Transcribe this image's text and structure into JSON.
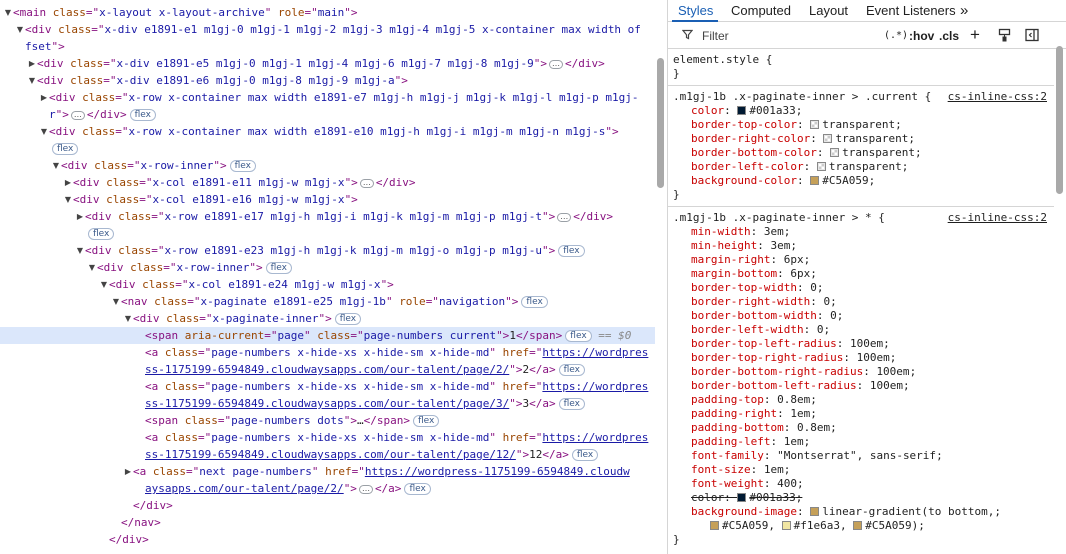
{
  "elements": {
    "lines": [
      {
        "indent": 0,
        "tri": "open",
        "parts": [
          [
            "tag",
            "<main "
          ],
          [
            "an",
            "class"
          ],
          [
            "tag",
            "=\""
          ],
          [
            "av",
            "x-layout x-layout-archive"
          ],
          [
            "tag",
            "\" "
          ],
          [
            "an",
            "role"
          ],
          [
            "tag",
            "=\""
          ],
          [
            "av",
            "main"
          ],
          [
            "tag",
            "\">"
          ]
        ]
      },
      {
        "indent": 1,
        "tri": "open",
        "parts": [
          [
            "tag",
            "<div "
          ],
          [
            "an",
            "class"
          ],
          [
            "tag",
            "=\""
          ],
          [
            "av",
            "x-div e1891-e1 m1gj-0 m1gj-1 m1gj-2 m1gj-3 m1gj-4 m1gj-5 x-container max width of"
          ]
        ]
      },
      {
        "indent": 1,
        "cont": true,
        "parts": [
          [
            "av",
            "fset"
          ],
          [
            "tag",
            "\">"
          ]
        ]
      },
      {
        "indent": 2,
        "tri": "closed",
        "parts": [
          [
            "tag",
            "<div "
          ],
          [
            "an",
            "class"
          ],
          [
            "tag",
            "=\""
          ],
          [
            "av",
            "x-div e1891-e5 m1gj-0 m1gj-1 m1gj-4 m1gj-6 m1gj-7 m1gj-8 m1gj-9"
          ],
          [
            "tag",
            "\">"
          ],
          [
            "ell",
            "…"
          ],
          [
            "tag",
            "</div>"
          ]
        ]
      },
      {
        "indent": 2,
        "tri": "open",
        "parts": [
          [
            "tag",
            "<div "
          ],
          [
            "an",
            "class"
          ],
          [
            "tag",
            "=\""
          ],
          [
            "av",
            "x-div e1891-e6 m1gj-0 m1gj-8 m1gj-9 m1gj-a"
          ],
          [
            "tag",
            "\">"
          ]
        ]
      },
      {
        "indent": 3,
        "tri": "closed",
        "parts": [
          [
            "tag",
            "<div "
          ],
          [
            "an",
            "class"
          ],
          [
            "tag",
            "=\""
          ],
          [
            "av",
            "x-row x-container max width e1891-e7 m1gj-h m1gj-j m1gj-k m1gj-l m1gj-p m1gj-"
          ]
        ]
      },
      {
        "indent": 3,
        "cont": true,
        "parts": [
          [
            "av",
            "r"
          ],
          [
            "tag",
            "\">"
          ],
          [
            "ell",
            "…"
          ],
          [
            "tag",
            "</div>"
          ],
          [
            "badge",
            "flex"
          ]
        ]
      },
      {
        "indent": 3,
        "tri": "open",
        "parts": [
          [
            "tag",
            "<div "
          ],
          [
            "an",
            "class"
          ],
          [
            "tag",
            "=\""
          ],
          [
            "av",
            "x-row x-container max width e1891-e10 m1gj-h m1gj-i m1gj-m m1gj-n m1gj-s"
          ],
          [
            "tag",
            "\">"
          ]
        ]
      },
      {
        "indent": 3,
        "cont": true,
        "parts": [
          [
            "badge",
            "flex"
          ]
        ]
      },
      {
        "indent": 4,
        "tri": "open",
        "parts": [
          [
            "tag",
            "<div "
          ],
          [
            "an",
            "class"
          ],
          [
            "tag",
            "=\""
          ],
          [
            "av",
            "x-row-inner"
          ],
          [
            "tag",
            "\">"
          ],
          [
            "badge",
            "flex"
          ]
        ]
      },
      {
        "indent": 5,
        "tri": "closed",
        "parts": [
          [
            "tag",
            "<div "
          ],
          [
            "an",
            "class"
          ],
          [
            "tag",
            "=\""
          ],
          [
            "av",
            "x-col e1891-e11 m1gj-w m1gj-x"
          ],
          [
            "tag",
            "\">"
          ],
          [
            "ell",
            "…"
          ],
          [
            "tag",
            "</div>"
          ]
        ]
      },
      {
        "indent": 5,
        "tri": "open",
        "parts": [
          [
            "tag",
            "<div "
          ],
          [
            "an",
            "class"
          ],
          [
            "tag",
            "=\""
          ],
          [
            "av",
            "x-col e1891-e16 m1gj-w m1gj-x"
          ],
          [
            "tag",
            "\">"
          ]
        ]
      },
      {
        "indent": 6,
        "tri": "closed",
        "parts": [
          [
            "tag",
            "<div "
          ],
          [
            "an",
            "class"
          ],
          [
            "tag",
            "=\""
          ],
          [
            "av",
            "x-row e1891-e17 m1gj-h m1gj-i m1gj-k m1gj-m m1gj-p m1gj-t"
          ],
          [
            "tag",
            "\">"
          ],
          [
            "ell",
            "…"
          ],
          [
            "tag",
            "</div>"
          ]
        ]
      },
      {
        "indent": 6,
        "cont": true,
        "parts": [
          [
            "badge",
            "flex"
          ]
        ]
      },
      {
        "indent": 6,
        "tri": "open",
        "parts": [
          [
            "tag",
            "<div "
          ],
          [
            "an",
            "class"
          ],
          [
            "tag",
            "=\""
          ],
          [
            "av",
            "x-row e1891-e23 m1gj-h m1gj-k m1gj-m m1gj-o m1gj-p m1gj-u"
          ],
          [
            "tag",
            "\">"
          ],
          [
            "badge",
            "flex"
          ]
        ]
      },
      {
        "indent": 7,
        "tri": "open",
        "parts": [
          [
            "tag",
            "<div "
          ],
          [
            "an",
            "class"
          ],
          [
            "tag",
            "=\""
          ],
          [
            "av",
            "x-row-inner"
          ],
          [
            "tag",
            "\">"
          ],
          [
            "badge",
            "flex"
          ]
        ]
      },
      {
        "indent": 8,
        "tri": "open",
        "parts": [
          [
            "tag",
            "<div "
          ],
          [
            "an",
            "class"
          ],
          [
            "tag",
            "=\""
          ],
          [
            "av",
            "x-col e1891-e24 m1gj-w m1gj-x"
          ],
          [
            "tag",
            "\">"
          ]
        ]
      },
      {
        "indent": 9,
        "tri": "open",
        "parts": [
          [
            "tag",
            "<nav "
          ],
          [
            "an",
            "class"
          ],
          [
            "tag",
            "=\""
          ],
          [
            "av",
            "x-paginate e1891-e25 m1gj-1b"
          ],
          [
            "tag",
            "\" "
          ],
          [
            "an",
            "role"
          ],
          [
            "tag",
            "=\""
          ],
          [
            "av",
            "navigation"
          ],
          [
            "tag",
            "\">"
          ],
          [
            "badge",
            "flex"
          ]
        ]
      },
      {
        "indent": 10,
        "tri": "open",
        "parts": [
          [
            "tag",
            "<div "
          ],
          [
            "an",
            "class"
          ],
          [
            "tag",
            "=\""
          ],
          [
            "av",
            "x-paginate-inner"
          ],
          [
            "tag",
            "\">"
          ],
          [
            "badge",
            "flex"
          ]
        ]
      },
      {
        "indent": 11,
        "selected": true,
        "parts": [
          [
            "tag",
            "<span "
          ],
          [
            "an",
            "aria-current"
          ],
          [
            "tag",
            "=\""
          ],
          [
            "av",
            "page"
          ],
          [
            "tag",
            "\" "
          ],
          [
            "an",
            "class"
          ],
          [
            "tag",
            "=\""
          ],
          [
            "av",
            "page-numbers current"
          ],
          [
            "tag",
            "\">"
          ],
          [
            "tx",
            "1"
          ],
          [
            "tag",
            "</span>"
          ],
          [
            "badge",
            "flex"
          ],
          [
            "dim",
            " == $0"
          ]
        ]
      },
      {
        "indent": 11,
        "parts": [
          [
            "tag",
            "<a "
          ],
          [
            "an",
            "class"
          ],
          [
            "tag",
            "=\""
          ],
          [
            "av",
            "page-numbers x-hide-xs x-hide-sm x-hide-md"
          ],
          [
            "tag",
            "\" "
          ],
          [
            "an",
            "href"
          ],
          [
            "tag",
            "=\""
          ],
          [
            "lk",
            "https://wordpres"
          ]
        ]
      },
      {
        "indent": 11,
        "cont": true,
        "parts": [
          [
            "lk",
            "ss-1175199-6594849.cloudwaysapps.com/our-talent/page/2/"
          ],
          [
            "tag",
            "\">"
          ],
          [
            "tx",
            "2"
          ],
          [
            "tag",
            "</a>"
          ],
          [
            "badge",
            "flex"
          ]
        ]
      },
      {
        "indent": 11,
        "parts": [
          [
            "tag",
            "<a "
          ],
          [
            "an",
            "class"
          ],
          [
            "tag",
            "=\""
          ],
          [
            "av",
            "page-numbers x-hide-xs x-hide-sm x-hide-md"
          ],
          [
            "tag",
            "\" "
          ],
          [
            "an",
            "href"
          ],
          [
            "tag",
            "=\""
          ],
          [
            "lk",
            "https://wordpres"
          ]
        ]
      },
      {
        "indent": 11,
        "cont": true,
        "parts": [
          [
            "lk",
            "ss-1175199-6594849.cloudwaysapps.com/our-talent/page/3/"
          ],
          [
            "tag",
            "\">"
          ],
          [
            "tx",
            "3"
          ],
          [
            "tag",
            "</a>"
          ],
          [
            "badge",
            "flex"
          ]
        ]
      },
      {
        "indent": 11,
        "parts": [
          [
            "tag",
            "<span "
          ],
          [
            "an",
            "class"
          ],
          [
            "tag",
            "=\""
          ],
          [
            "av",
            "page-numbers dots"
          ],
          [
            "tag",
            "\">"
          ],
          [
            "tx",
            "…"
          ],
          [
            "tag",
            "</span>"
          ],
          [
            "badge",
            "flex"
          ]
        ]
      },
      {
        "indent": 11,
        "parts": [
          [
            "tag",
            "<a "
          ],
          [
            "an",
            "class"
          ],
          [
            "tag",
            "=\""
          ],
          [
            "av",
            "page-numbers x-hide-xs x-hide-sm x-hide-md"
          ],
          [
            "tag",
            "\" "
          ],
          [
            "an",
            "href"
          ],
          [
            "tag",
            "=\""
          ],
          [
            "lk",
            "https://wordpres"
          ]
        ]
      },
      {
        "indent": 11,
        "cont": true,
        "parts": [
          [
            "lk",
            "ss-1175199-6594849.cloudwaysapps.com/our-talent/page/12/"
          ],
          [
            "tag",
            "\">"
          ],
          [
            "tx",
            "12"
          ],
          [
            "tag",
            "</a>"
          ],
          [
            "badge",
            "flex"
          ]
        ]
      },
      {
        "indent": 10,
        "tri": "closed",
        "parts": [
          [
            "tag",
            "<a "
          ],
          [
            "an",
            "class"
          ],
          [
            "tag",
            "=\""
          ],
          [
            "av",
            "next page-numbers"
          ],
          [
            "tag",
            "\" "
          ],
          [
            "an",
            "href"
          ],
          [
            "tag",
            "=\""
          ],
          [
            "lk",
            "https://wordpress-1175199-6594849.cloudw"
          ]
        ]
      },
      {
        "indent": 11,
        "cont": true,
        "parts": [
          [
            "lk",
            "aysapps.com/our-talent/page/2/"
          ],
          [
            "tag",
            "\">"
          ],
          [
            "ell",
            "…"
          ],
          [
            "tag",
            "</a>"
          ],
          [
            "badge",
            "flex"
          ]
        ]
      },
      {
        "indent": 10,
        "parts": [
          [
            "tag",
            "</div>"
          ]
        ]
      },
      {
        "indent": 9,
        "parts": [
          [
            "tag",
            "</nav>"
          ]
        ]
      },
      {
        "indent": 8,
        "parts": [
          [
            "tag",
            "</div>"
          ]
        ]
      }
    ]
  },
  "styles": {
    "tabs": [
      "Styles",
      "Computed",
      "Layout",
      "Event Listeners"
    ],
    "tabs_more": "»",
    "filter_placeholder": "Filter",
    "toolbar": {
      "pseudo": "(.*)",
      "hov": ":hov",
      "cls": ".cls",
      "add": "+"
    },
    "element_style": {
      "selector": "element.style {",
      "close": "}"
    },
    "rule1": {
      "selector": ".m1gj-1b .x-paginate-inner > .current {",
      "source": "cs-inline-css:2",
      "decls": [
        {
          "name": "color",
          "value": "#001a33",
          "swatch": "#001a33"
        },
        {
          "name": "border-top-color",
          "value": "transparent",
          "swatch": "checker"
        },
        {
          "name": "border-right-color",
          "value": "transparent",
          "swatch": "checker"
        },
        {
          "name": "border-bottom-color",
          "value": "transparent",
          "swatch": "checker"
        },
        {
          "name": "border-left-color",
          "value": "transparent",
          "swatch": "checker"
        },
        {
          "name": "background-color",
          "value": "#C5A059",
          "swatch": "#C5A059"
        }
      ],
      "close": "}"
    },
    "rule2": {
      "selector": ".m1gj-1b .x-paginate-inner > * {",
      "source": "cs-inline-css:2",
      "decls": [
        {
          "name": "min-width",
          "value": "3em"
        },
        {
          "name": "min-height",
          "value": "3em"
        },
        {
          "name": "margin-right",
          "value": "6px"
        },
        {
          "name": "margin-bottom",
          "value": "6px"
        },
        {
          "name": "border-top-width",
          "value": "0"
        },
        {
          "name": "border-right-width",
          "value": "0"
        },
        {
          "name": "border-bottom-width",
          "value": "0"
        },
        {
          "name": "border-left-width",
          "value": "0"
        },
        {
          "name": "border-top-left-radius",
          "value": "100em"
        },
        {
          "name": "border-top-right-radius",
          "value": "100em"
        },
        {
          "name": "border-bottom-right-radius",
          "value": "100em"
        },
        {
          "name": "border-bottom-left-radius",
          "value": "100em"
        },
        {
          "name": "padding-top",
          "value": "0.8em"
        },
        {
          "name": "padding-right",
          "value": "1em"
        },
        {
          "name": "padding-bottom",
          "value": "0.8em"
        },
        {
          "name": "padding-left",
          "value": "1em"
        },
        {
          "name": "font-family",
          "value": "\"Montserrat\", sans-serif"
        },
        {
          "name": "font-size",
          "value": "1em"
        },
        {
          "name": "font-weight",
          "value": "400"
        },
        {
          "name": "color",
          "value": "#001a33",
          "swatch": "#001a33",
          "struck": true
        },
        {
          "name": "background-image",
          "value": "linear-gradient(to bottom,",
          "swatch": "#C5A059"
        }
      ],
      "gradient_line": [
        "#C5A059",
        "#f1e6a3",
        "#C5A059"
      ],
      "gradient_tail": ");",
      "close": "}"
    }
  }
}
